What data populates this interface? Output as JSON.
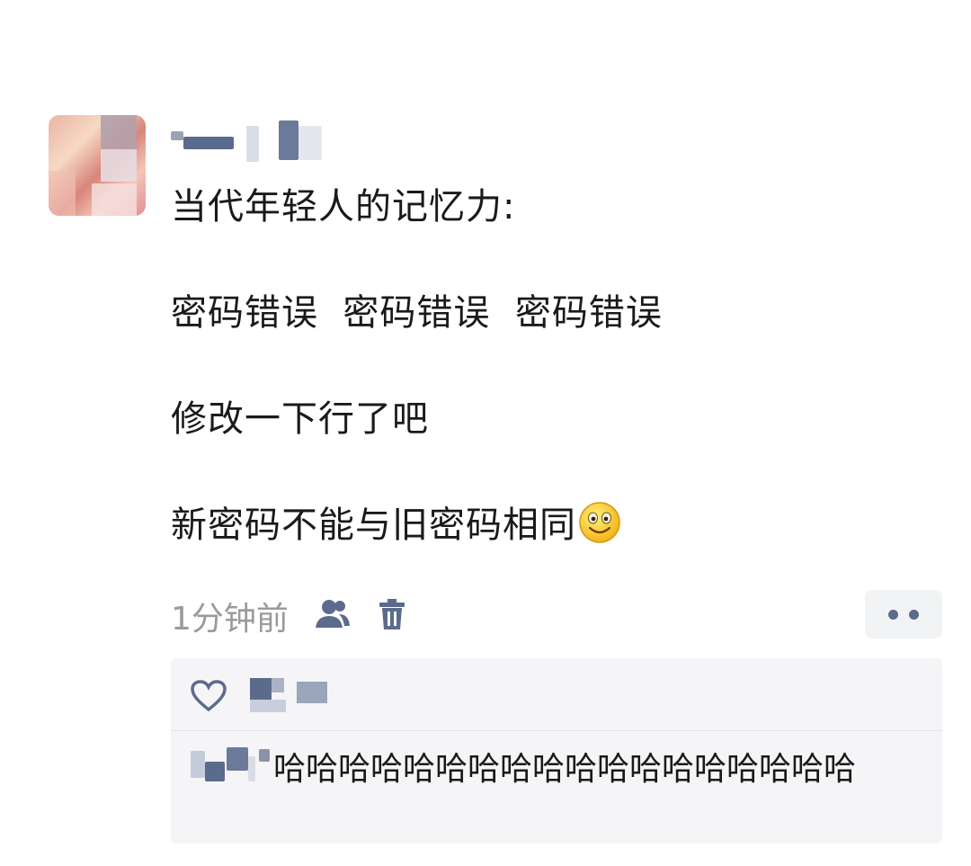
{
  "post": {
    "avatar": "avatar-image",
    "lines": [
      "当代年轻人的记忆力:",
      "密码错误  密码错误  密码错误",
      "修改一下行了吧",
      "新密码不能与旧密码相同"
    ],
    "emoji": "smile-emoji"
  },
  "meta": {
    "time": "1分钟前",
    "visibility_icon": "friends-icon",
    "delete_icon": "trash-icon",
    "more_icon": "more-dots-icon"
  },
  "comments": {
    "like_icon": "heart-icon",
    "items": [
      {
        "text": "哈哈哈哈哈哈哈哈哈哈哈哈哈哈哈哈哈哈"
      }
    ]
  },
  "colors": {
    "link_blue": "#5b6b8c",
    "muted": "#9a9a9a",
    "comment_bg": "#f5f5f7"
  }
}
